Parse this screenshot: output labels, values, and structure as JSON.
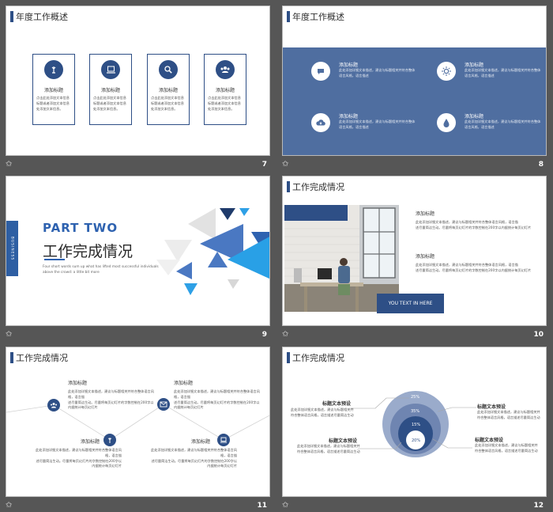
{
  "colors": {
    "navy": "#2e4f86",
    "band": "#4f6ea0",
    "accent": "#2e62b0",
    "bg": "#565656"
  },
  "common": {
    "add_title": "添加标题",
    "body_long": "点击此处添加文本信息标题或者添加文本信息处添加文本信息。",
    "body_short": "点击添加说明文字说明文字，并且阐述内容",
    "line_a": "此处添加详细文本描述，建议与标题相关并符合整体语言风格，语言描述",
    "line_b": "尽量简洁生动。尽量将每页幻灯片的字数控制在200字以内",
    "line_c": "此处添加详细文本描述，建议与标题相关并符合整体语言风格，语言描",
    "line_d": "述尽量简洁生动。尽量将每页幻灯片的字数控制在200字以内据统计每页幻灯片",
    "line_e": "的最好控制在5分钟之内",
    "label_title": "标题文本预设",
    "label_line1": "此处添加详细文本描述，建议与标题相关并",
    "label_line2": "符合整体语言风格，语言描述尽量简洁生动"
  },
  "slides": [
    {
      "number": "7",
      "title": "年度工作概述",
      "icons": [
        "bar-icon",
        "laptop-icon",
        "search-icon",
        "people-icon"
      ]
    },
    {
      "number": "8",
      "title": "年度工作概述",
      "icons": [
        "chat-icon",
        "sun-icon",
        "cloud-icon",
        "drop-icon"
      ]
    },
    {
      "number": "9",
      "side_tab": "BUSINESS",
      "part": "PART TWO",
      "title": "工作完成情况",
      "subtitle": "Four short words sum up what has lifted most successful individuals above the crowd: a little bit more"
    },
    {
      "number": "10",
      "title": "工作完成情况",
      "button": "YOU TEXT IN HERE"
    },
    {
      "number": "11",
      "title": "工作完成情况"
    },
    {
      "number": "12",
      "title": "工作完成情况",
      "rings": [
        "25%",
        "35%",
        "15%",
        "20%"
      ]
    }
  ],
  "star_glyph": "✩"
}
